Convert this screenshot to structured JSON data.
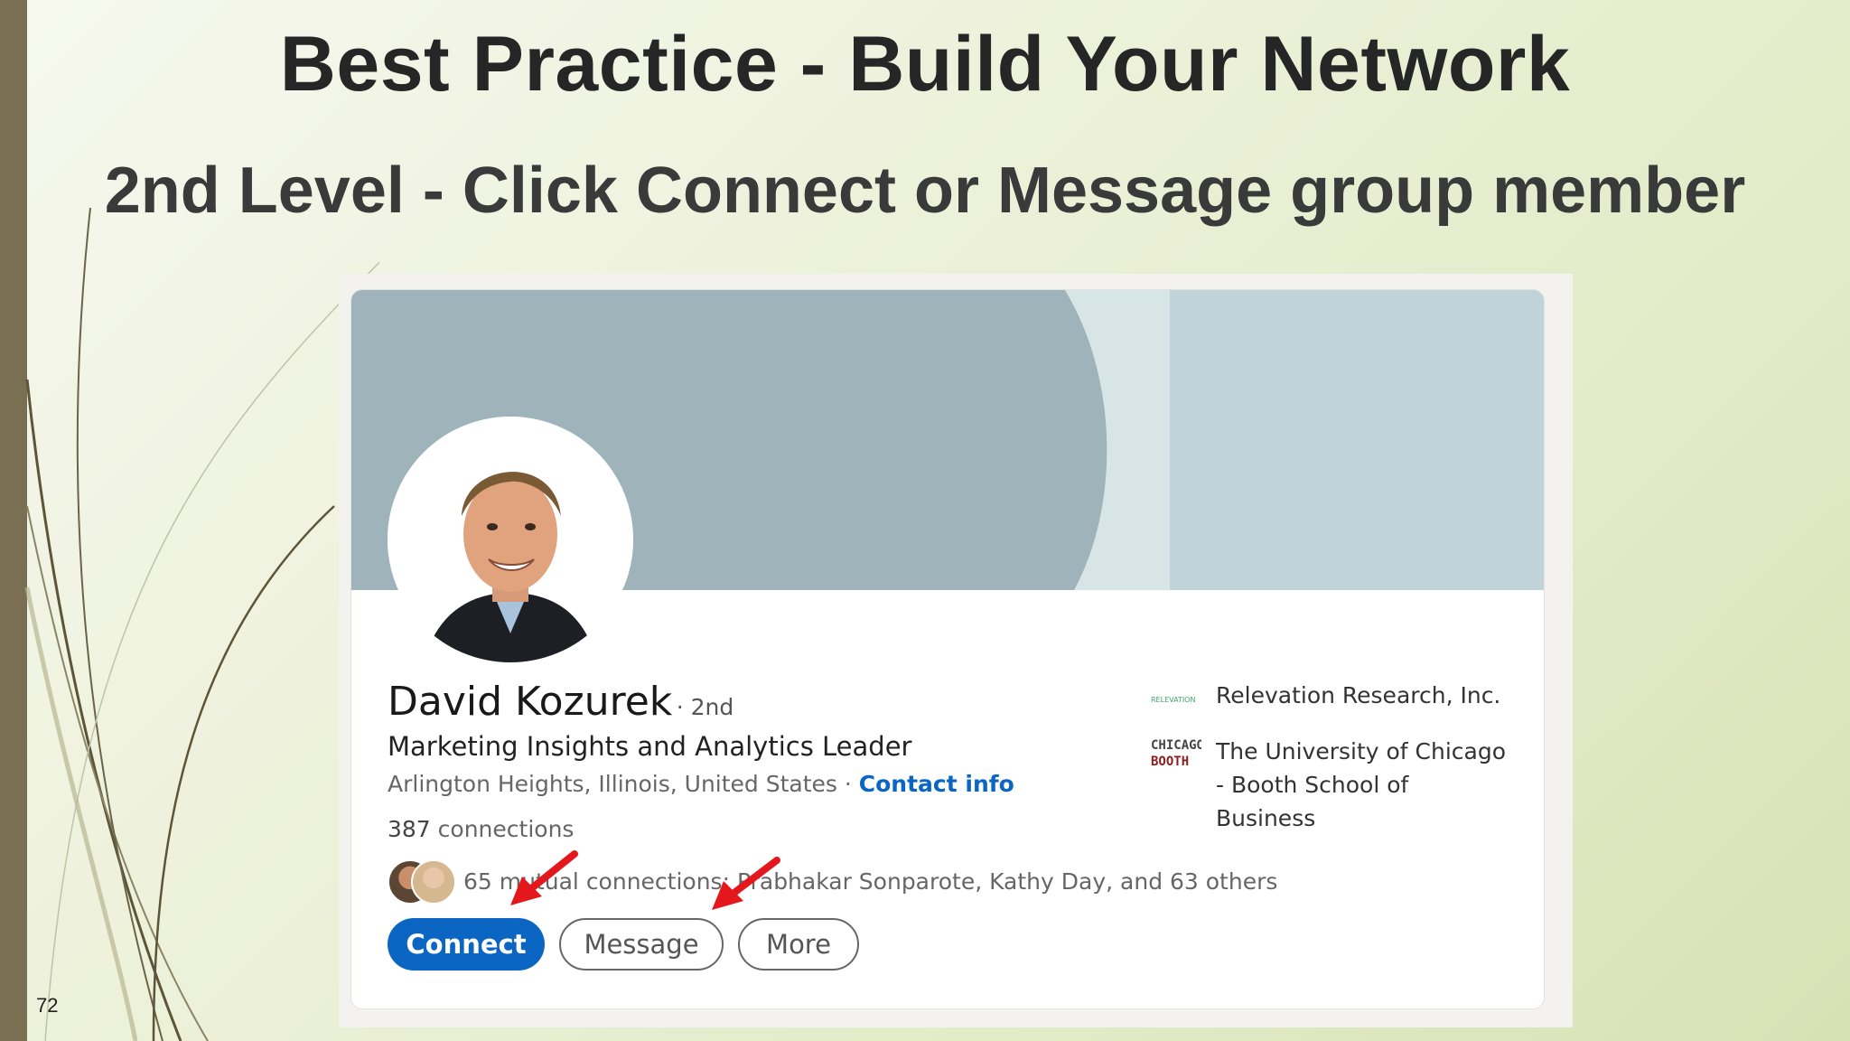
{
  "slide": {
    "title": "Best Practice - Build Your Network",
    "subtitle": "2nd Level - Click Connect or Message group member",
    "page_number": "72"
  },
  "profile": {
    "name": "David Kozurek",
    "degree": "· 2nd",
    "headline": "Marketing Insights and Analytics Leader",
    "location": "Arlington Heights, Illinois, United States",
    "location_separator": " · ",
    "contact_info_label": "Contact info",
    "connections_count": "387",
    "connections_label": " connections",
    "mutual_connections_text": "65 mutual connections: Prabhakar Sonparote, Kathy Day, and 63 others"
  },
  "actions": {
    "connect_label": "Connect",
    "message_label": "Message",
    "more_label": "More"
  },
  "experience": [
    {
      "org": "Relevation Research, Inc.",
      "logo_text": "RELEVATION"
    },
    {
      "org": "The University of Chicago - Booth School of Business",
      "logo_text": "CHICAGO BOOTH"
    }
  ],
  "colors": {
    "linkedin_blue": "#0a66c2",
    "banner_dark": "#9fb3ba",
    "banner_light": "#bfd3d8",
    "annotation_arrow": "#e3171c",
    "slide_accent": "#7a6f52"
  },
  "icons": [
    "portrait-photo",
    "mutual-avatar-icon",
    "relevation-logo-icon",
    "chicago-booth-logo-icon",
    "red-arrow-icon"
  ]
}
